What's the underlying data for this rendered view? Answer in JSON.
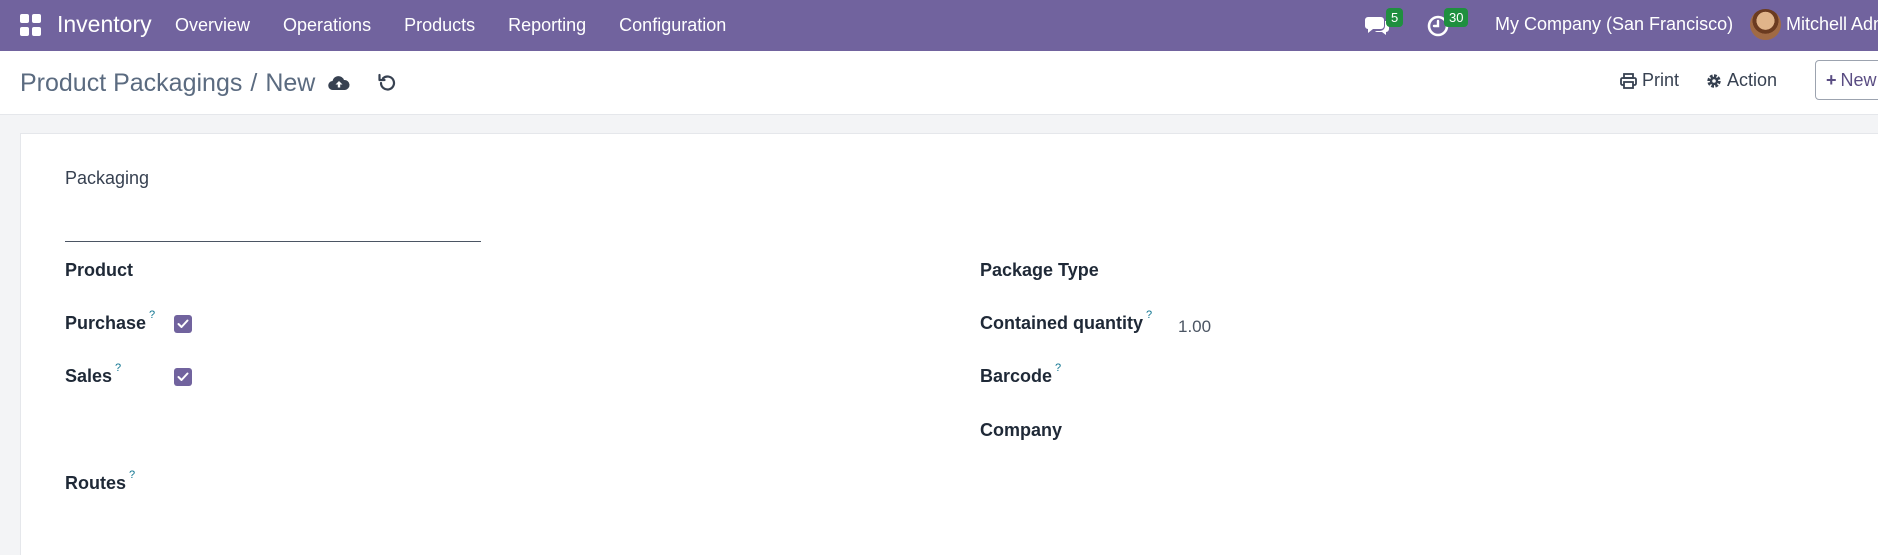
{
  "navbar": {
    "brand": "Inventory",
    "menu": [
      "Overview",
      "Operations",
      "Products",
      "Reporting",
      "Configuration"
    ],
    "chat_count": "5",
    "activity_count": "30",
    "company": "My Company (San Francisco)",
    "user": "Mitchell Adm"
  },
  "breadcrumb": {
    "parent": "Product Packagings",
    "separator": "/",
    "current": "New"
  },
  "actions": {
    "print": "Print",
    "action": "Action",
    "new": "New"
  },
  "form": {
    "packaging_label": "Packaging",
    "packaging_value": "",
    "product_label": "Product",
    "purchase_label": "Purchase",
    "purchase_checked": true,
    "sales_label": "Sales",
    "sales_checked": true,
    "routes_label": "Routes",
    "package_type_label": "Package Type",
    "contained_qty_label": "Contained quantity",
    "contained_qty_value": "1.00",
    "barcode_label": "Barcode",
    "company_label": "Company",
    "help_mark": "?"
  },
  "colors": {
    "navbar": "#71639e",
    "badge": "#1f8f3f",
    "checkbox": "#71639e"
  }
}
